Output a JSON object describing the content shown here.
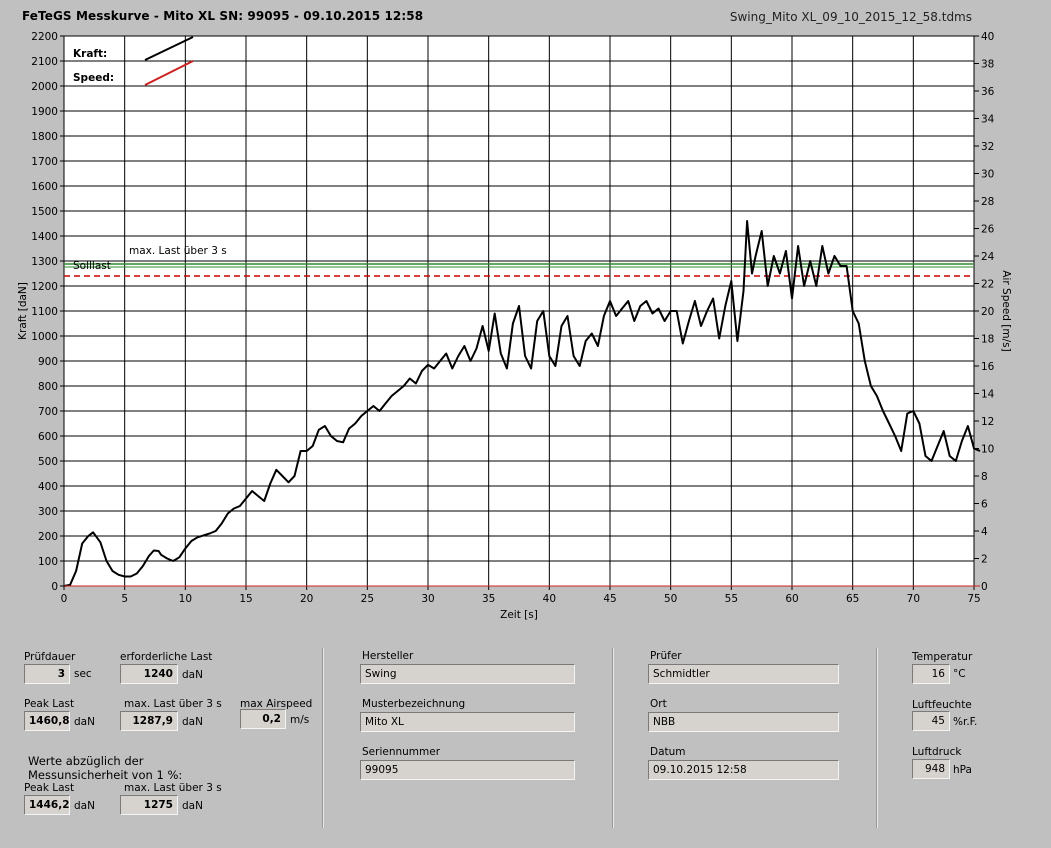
{
  "header": {
    "title": "FeTeGS Messkurve - Mito XL  SN: 99095 - 09.10.2015 12:58",
    "filename": "Swing_Mito XL_09_10_2015_12_58.tdms"
  },
  "chart_data": {
    "type": "line",
    "xlabel": "Zeit [s]",
    "ylabel": "Kraft [daN]",
    "y2label": "Air Speed [m/s]",
    "xlim": [
      0,
      75
    ],
    "ylim": [
      0,
      2200
    ],
    "y2lim": [
      0,
      40
    ],
    "x_ticks": [
      "0",
      "5",
      "10",
      "15",
      "20",
      "25",
      "30",
      "35",
      "40",
      "45",
      "50",
      "55",
      "60",
      "65",
      "70",
      "75"
    ],
    "y_ticks": [
      "0",
      "100",
      "200",
      "300",
      "400",
      "500",
      "600",
      "700",
      "800",
      "900",
      "1000",
      "1100",
      "1200",
      "1300",
      "1400",
      "1500",
      "1600",
      "1700",
      "1800",
      "1900",
      "2000",
      "2100",
      "2200"
    ],
    "y2_ticks": [
      "0",
      "2",
      "4",
      "6",
      "8",
      "10",
      "12",
      "14",
      "16",
      "18",
      "20",
      "22",
      "24",
      "26",
      "28",
      "30",
      "32",
      "34",
      "36",
      "38",
      "40"
    ],
    "legend": [
      {
        "label": "Kraft:",
        "color": "#000000"
      },
      {
        "label": "Speed:",
        "color": "#cc2020"
      }
    ],
    "reference_lines": [
      {
        "label": "max. Last über  3 s",
        "value": 1287.9,
        "color": "#2e8b2e"
      },
      {
        "label": "Solllast",
        "value": 1240,
        "color": "#cc0000"
      }
    ],
    "series": [
      {
        "name": "Kraft",
        "color": "#000000",
        "points": [
          [
            0,
            0
          ],
          [
            0.5,
            5
          ],
          [
            1,
            60
          ],
          [
            1.5,
            170
          ],
          [
            2,
            200
          ],
          [
            2.4,
            215
          ],
          [
            3,
            175
          ],
          [
            3.5,
            100
          ],
          [
            4,
            60
          ],
          [
            4.5,
            45
          ],
          [
            5,
            38
          ],
          [
            5.5,
            38
          ],
          [
            6,
            50
          ],
          [
            6.5,
            80
          ],
          [
            7,
            120
          ],
          [
            7.4,
            142
          ],
          [
            7.8,
            140
          ],
          [
            8,
            125
          ],
          [
            8.5,
            110
          ],
          [
            9,
            100
          ],
          [
            9.5,
            115
          ],
          [
            10,
            150
          ],
          [
            10.5,
            180
          ],
          [
            11,
            195
          ],
          [
            12,
            210
          ],
          [
            12.5,
            220
          ],
          [
            13,
            250
          ],
          [
            13.5,
            290
          ],
          [
            14,
            310
          ],
          [
            14.5,
            320
          ],
          [
            15,
            350
          ],
          [
            15.5,
            380
          ],
          [
            16,
            360
          ],
          [
            16.5,
            340
          ],
          [
            17,
            410
          ],
          [
            17.5,
            465
          ],
          [
            18,
            440
          ],
          [
            18.5,
            415
          ],
          [
            19,
            440
          ],
          [
            19.5,
            540
          ],
          [
            20,
            540
          ],
          [
            20.5,
            560
          ],
          [
            21,
            625
          ],
          [
            21.5,
            640
          ],
          [
            22,
            600
          ],
          [
            22.5,
            580
          ],
          [
            23,
            575
          ],
          [
            23.5,
            630
          ],
          [
            24,
            650
          ],
          [
            24.5,
            680
          ],
          [
            25,
            700
          ],
          [
            25.5,
            720
          ],
          [
            26,
            700
          ],
          [
            26.5,
            730
          ],
          [
            27,
            760
          ],
          [
            27.5,
            780
          ],
          [
            28,
            800
          ],
          [
            28.5,
            830
          ],
          [
            29,
            810
          ],
          [
            29.5,
            860
          ],
          [
            30,
            885
          ],
          [
            30.5,
            870
          ],
          [
            31,
            900
          ],
          [
            31.5,
            930
          ],
          [
            32,
            870
          ],
          [
            32.5,
            920
          ],
          [
            33,
            960
          ],
          [
            33.5,
            900
          ],
          [
            34,
            950
          ],
          [
            34.5,
            1040
          ],
          [
            35,
            940
          ],
          [
            35.5,
            1090
          ],
          [
            36,
            930
          ],
          [
            36.5,
            870
          ],
          [
            37,
            1050
          ],
          [
            37.5,
            1120
          ],
          [
            38,
            920
          ],
          [
            38.5,
            870
          ],
          [
            39,
            1060
          ],
          [
            39.5,
            1100
          ],
          [
            40,
            920
          ],
          [
            40.5,
            880
          ],
          [
            41,
            1040
          ],
          [
            41.5,
            1080
          ],
          [
            42,
            920
          ],
          [
            42.5,
            880
          ],
          [
            43,
            980
          ],
          [
            43.5,
            1010
          ],
          [
            44,
            960
          ],
          [
            44.5,
            1080
          ],
          [
            45,
            1140
          ],
          [
            45.5,
            1080
          ],
          [
            46,
            1110
          ],
          [
            46.5,
            1140
          ],
          [
            47,
            1060
          ],
          [
            47.5,
            1120
          ],
          [
            48,
            1140
          ],
          [
            48.5,
            1090
          ],
          [
            49,
            1110
          ],
          [
            49.5,
            1060
          ],
          [
            50,
            1100
          ],
          [
            50.5,
            1100
          ],
          [
            51,
            970
          ],
          [
            51.5,
            1060
          ],
          [
            52,
            1140
          ],
          [
            52.5,
            1040
          ],
          [
            53,
            1100
          ],
          [
            53.5,
            1150
          ],
          [
            54,
            990
          ],
          [
            54.5,
            1120
          ],
          [
            55,
            1220
          ],
          [
            55.5,
            980
          ],
          [
            56,
            1180
          ],
          [
            56.3,
            1460
          ],
          [
            56.7,
            1250
          ],
          [
            57,
            1320
          ],
          [
            57.5,
            1420
          ],
          [
            58,
            1200
          ],
          [
            58.5,
            1320
          ],
          [
            59,
            1250
          ],
          [
            59.5,
            1340
          ],
          [
            60,
            1150
          ],
          [
            60.5,
            1360
          ],
          [
            61,
            1200
          ],
          [
            61.5,
            1300
          ],
          [
            62,
            1200
          ],
          [
            62.5,
            1360
          ],
          [
            63,
            1250
          ],
          [
            63.5,
            1320
          ],
          [
            64,
            1280
          ],
          [
            64.5,
            1280
          ],
          [
            65,
            1100
          ],
          [
            65.5,
            1050
          ],
          [
            66,
            900
          ],
          [
            66.5,
            800
          ],
          [
            67,
            760
          ],
          [
            67.5,
            700
          ],
          [
            68,
            650
          ],
          [
            68.5,
            600
          ],
          [
            69,
            540
          ],
          [
            69.5,
            690
          ],
          [
            70,
            700
          ],
          [
            70.5,
            650
          ],
          [
            71,
            520
          ],
          [
            71.5,
            500
          ],
          [
            72,
            560
          ],
          [
            72.5,
            620
          ],
          [
            73,
            520
          ],
          [
            73.5,
            500
          ],
          [
            74,
            580
          ],
          [
            74.5,
            640
          ],
          [
            75,
            550
          ],
          [
            75.5,
            540
          ]
        ]
      },
      {
        "name": "Speed",
        "color": "#cc2020",
        "points": [
          [
            0,
            0
          ],
          [
            75.5,
            0
          ]
        ]
      }
    ]
  },
  "labels": {
    "pruefdauer": "Prüfdauer",
    "erforderliche_last": "erforderliche Last",
    "peak_last": "Peak Last",
    "max_last": "max. Last über  3 s",
    "max_airspeed": "max Airspeed",
    "werte_note_line1": "Werte abzüglich der",
    "werte_note_line2": "Messunsicherheit von 1  %:",
    "peak_last_2": "Peak Last",
    "max_last_2": "max. Last über  3 s",
    "hersteller": "Hersteller",
    "musterbezeichnung": "Musterbezeichnung",
    "seriennummer": "Seriennummer",
    "pruefer": "Prüfer",
    "ort": "Ort",
    "datum": "Datum",
    "temperatur": "Temperatur",
    "luftfeuchte": "Luftfeuchte",
    "luftdruck": "Luftdruck"
  },
  "values": {
    "pruefdauer": "3",
    "erforderliche_last": "1240",
    "peak_last": "1460,8",
    "max_last": "1287,9",
    "max_airspeed": "0,2",
    "peak_last_2": "1446,2",
    "max_last_2": "1275",
    "hersteller": "Swing",
    "musterbezeichnung": "Mito XL",
    "seriennummer": "99095",
    "pruefer": "Schmidtler",
    "ort": "NBB",
    "datum": "09.10.2015 12:58",
    "temperatur": "16",
    "luftfeuchte": "45",
    "luftdruck": "948"
  },
  "units": {
    "sec": "sec",
    "dan": "daN",
    "ms": "m/s",
    "celsius": "°C",
    "rf": "%r.F.",
    "hpa": "hPa"
  }
}
